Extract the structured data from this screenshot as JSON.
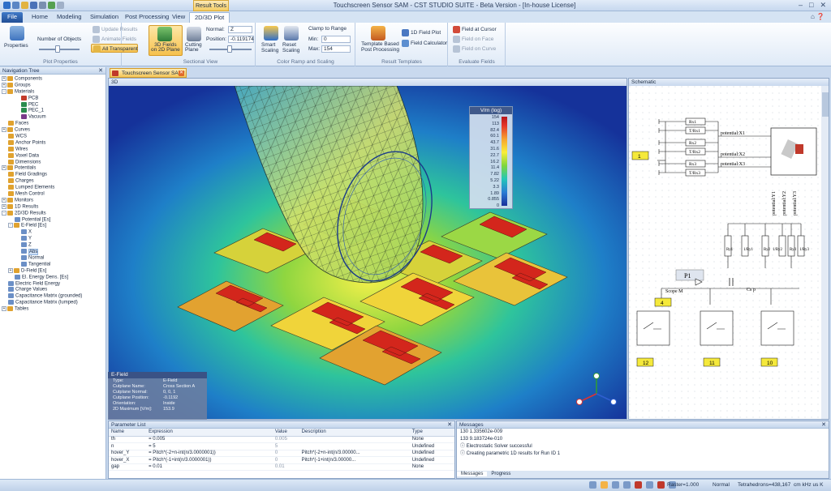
{
  "titlebar": {
    "title": "Touchscreen Sensor SAM - CST STUDIO SUITE - Beta Version - [In-house License]",
    "context_tab": "Result Tools"
  },
  "tabs": [
    "File",
    "Home",
    "Modeling",
    "Simulation",
    "Post Processing",
    "View",
    "2D/3D Plot"
  ],
  "ribbon": {
    "properties": "Properties",
    "num_objects": "Number of Objects",
    "update_results": "Update Results",
    "animate_fields": "Animate Fields",
    "all_transparent": "All Transparent",
    "plot_properties": "Plot Properties",
    "fields_2d": "3D Fields\non 2D Plane",
    "cutting_plane": "Cutting\nPlane",
    "normal_label": "Normal:",
    "normal_value": "Z",
    "position_label": "Position:",
    "position_value": "-0.119174",
    "sectional_view": "Sectional View",
    "smart_scaling": "Smart\nScaling",
    "reset_scaling": "Reset\nScaling",
    "clamp": "Clamp to Range",
    "min_label": "Min:",
    "min_value": "0",
    "max_label": "Max:",
    "max_value": "154",
    "color_ramp": "Color Ramp and Scaling",
    "template_pp": "Template Based\nPost Processing",
    "field_1d": "1D Field Plot",
    "field_calc": "Field Calculator",
    "result_templates": "Result Templates",
    "field_cursor": "Field at Cursor",
    "field_face": "Field on Face",
    "field_curve": "Field on Curve",
    "evaluate_fields": "Evaluate Fields"
  },
  "nav": {
    "title": "Navigation Tree",
    "items": [
      {
        "label": "Components",
        "indent": 0,
        "toggle": "+",
        "color": "#e0a22f"
      },
      {
        "label": "Groups",
        "indent": 0,
        "toggle": "+",
        "color": "#e0a22f"
      },
      {
        "label": "Materials",
        "indent": 0,
        "toggle": "-",
        "color": "#e0a22f"
      },
      {
        "label": "PCB",
        "indent": 2,
        "toggle": "",
        "color": "#c33b2a"
      },
      {
        "label": "PEC",
        "indent": 2,
        "toggle": "",
        "color": "#2a8b4d"
      },
      {
        "label": "PEC_1",
        "indent": 2,
        "toggle": "",
        "color": "#2a8b4d"
      },
      {
        "label": "Vacuum",
        "indent": 2,
        "toggle": "",
        "color": "#7a3a8a"
      },
      {
        "label": "Faces",
        "indent": 0,
        "toggle": "",
        "color": "#e0a22f"
      },
      {
        "label": "Curves",
        "indent": 0,
        "toggle": "+",
        "color": "#e0a22f"
      },
      {
        "label": "WCS",
        "indent": 0,
        "toggle": "",
        "color": "#e0a22f"
      },
      {
        "label": "Anchor Points",
        "indent": 0,
        "toggle": "",
        "color": "#e0a22f"
      },
      {
        "label": "Wires",
        "indent": 0,
        "toggle": "",
        "color": "#e0a22f"
      },
      {
        "label": "Voxel Data",
        "indent": 0,
        "toggle": "",
        "color": "#e0a22f"
      },
      {
        "label": "Dimensions",
        "indent": 0,
        "toggle": "",
        "color": "#e0a22f"
      },
      {
        "label": "Potentials",
        "indent": 0,
        "toggle": "+",
        "color": "#e0a22f"
      },
      {
        "label": "Field Gradings",
        "indent": 0,
        "toggle": "",
        "color": "#e0a22f"
      },
      {
        "label": "Charges",
        "indent": 0,
        "toggle": "",
        "color": "#e0a22f"
      },
      {
        "label": "Lumped Elements",
        "indent": 0,
        "toggle": "",
        "color": "#e0a22f"
      },
      {
        "label": "Mesh Control",
        "indent": 0,
        "toggle": "",
        "color": "#e0a22f"
      },
      {
        "label": "Monitors",
        "indent": 0,
        "toggle": "+",
        "color": "#e0a22f"
      },
      {
        "label": "1D Results",
        "indent": 0,
        "toggle": "+",
        "color": "#e0a22f"
      },
      {
        "label": "2D/3D Results",
        "indent": 0,
        "toggle": "-",
        "color": "#e0a22f"
      },
      {
        "label": "Potential [Es]",
        "indent": 1,
        "toggle": "",
        "color": "#6b8fc6"
      },
      {
        "label": "E-Field [Es]",
        "indent": 1,
        "toggle": "-",
        "color": "#e0a22f"
      },
      {
        "label": "X",
        "indent": 2,
        "toggle": "",
        "color": "#6b8fc6"
      },
      {
        "label": "Y",
        "indent": 2,
        "toggle": "",
        "color": "#6b8fc6"
      },
      {
        "label": "Z",
        "indent": 2,
        "toggle": "",
        "color": "#6b8fc6"
      },
      {
        "label": "Abs",
        "indent": 2,
        "toggle": "",
        "color": "#6b8fc6",
        "selected": true
      },
      {
        "label": "Normal",
        "indent": 2,
        "toggle": "",
        "color": "#6b8fc6"
      },
      {
        "label": "Tangential",
        "indent": 2,
        "toggle": "",
        "color": "#6b8fc6"
      },
      {
        "label": "D-Field [Es]",
        "indent": 1,
        "toggle": "+",
        "color": "#e0a22f"
      },
      {
        "label": "El. Energy Dens. [Es]",
        "indent": 1,
        "toggle": "",
        "color": "#6b8fc6"
      },
      {
        "label": "Electric Field Energy",
        "indent": 0,
        "toggle": "",
        "color": "#6b8fc6"
      },
      {
        "label": "Charge Values",
        "indent": 0,
        "toggle": "",
        "color": "#6b8fc6"
      },
      {
        "label": "Capacitance Matrix (grounded)",
        "indent": 0,
        "toggle": "",
        "color": "#6b8fc6"
      },
      {
        "label": "Capacitance Matrix (lumped)",
        "indent": 0,
        "toggle": "",
        "color": "#6b8fc6"
      },
      {
        "label": "Tables",
        "indent": 0,
        "toggle": "+",
        "color": "#e0a22f"
      }
    ]
  },
  "doc_tab": "Touchscreen Sensor SAM*",
  "view3d_label": "3D",
  "legend": {
    "title": "V/m (log)",
    "values": [
      "154",
      "113",
      "82.4",
      "60.1",
      "43.7",
      "31.6",
      "22.7",
      "16.2",
      "11.4",
      "7.82",
      "5.22",
      "3.3",
      "1.89",
      "0.855",
      "0"
    ]
  },
  "info": {
    "title": "E-Field",
    "rows": [
      [
        "Type:",
        "E-Field"
      ],
      [
        "Cutplane Name:",
        "Cross Section A"
      ],
      [
        "Cutplane Normal:",
        "0, 0, 1"
      ],
      [
        "Cutplane Position:",
        "-0.1192"
      ],
      [
        "Orientation:",
        "Inside"
      ],
      [
        "2D Maximum [V/m]:",
        "153.9"
      ]
    ]
  },
  "schematic": {
    "title": "Schematic",
    "resistors": [
      "Rx1",
      "T/Rx1",
      "Rx2",
      "T/Rx2",
      "Rx3",
      "T/Rx3"
    ],
    "potentials": [
      "potential:X1",
      "potential:X2",
      "potential:X3"
    ],
    "potentials_y": [
      "potential:Y1",
      "potential:Y2",
      "potential:Y3"
    ],
    "ry": [
      "Ry1",
      "1/Ry1",
      "Ry2",
      "1/Ry2",
      "Ry3",
      "1/Ry3"
    ],
    "probe": "P1",
    "scope": "Scope M",
    "cap": "Cs p",
    "ports": [
      "1",
      "4",
      "12",
      "11",
      "10"
    ]
  },
  "params": {
    "title": "Parameter List",
    "headers": [
      "Name",
      "Expression",
      "Value",
      "Description",
      "Type"
    ],
    "rows": [
      [
        "th",
        "= 0.005",
        "0.005",
        "",
        "None"
      ],
      [
        "n",
        "= 5",
        "5",
        "",
        "Undefined"
      ],
      [
        "hover_Y",
        "= Pitch*(-2+n-int(n/3.0000001))",
        "0",
        "Pitch*(-2+n-int(n/3.00000...",
        "Undefined"
      ],
      [
        "hover_X",
        "= Pitch*(-1+int(n/3.0000001))",
        "0",
        "Pitch*(-1+int(n/3.00000...",
        "Undefined"
      ],
      [
        "gap",
        "= 0.01",
        "0.01",
        "",
        "None"
      ]
    ]
  },
  "messages": {
    "title": "Messages",
    "lines": [
      "130      1.335602e-009",
      "133      9.183724e-010",
      "Electrostatic Solver successful",
      "Creating parametric 1D results for Run ID 1"
    ],
    "tabs": [
      "Messages",
      "Progress"
    ]
  },
  "status": {
    "raster": "Raster=1.000",
    "mode": "Normal",
    "tetra": "Tetrahedrons=438,167",
    "units": "cm  kHz  us  K"
  }
}
